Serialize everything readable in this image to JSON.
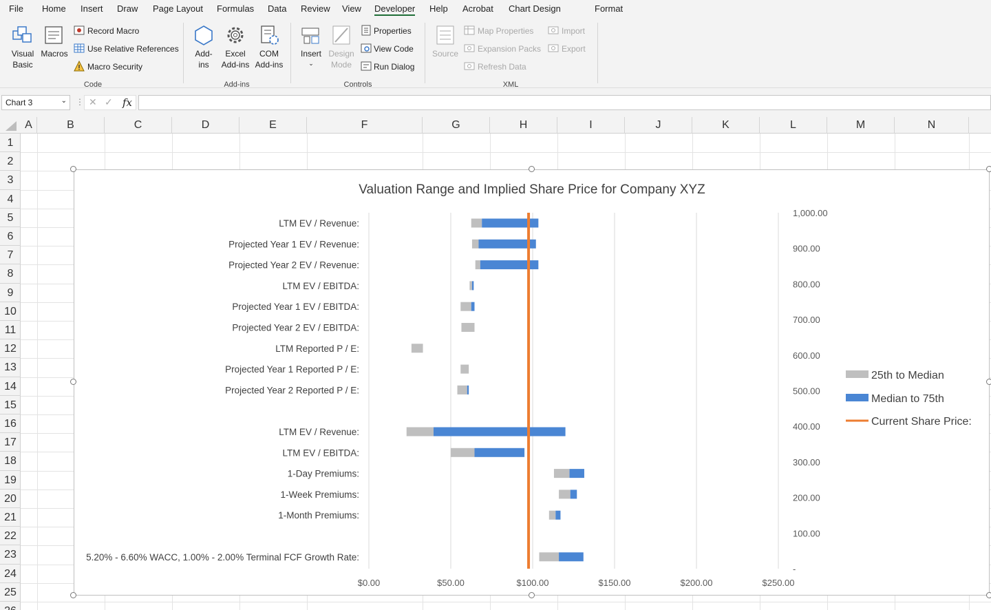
{
  "menu": {
    "items": [
      "File",
      "Home",
      "Insert",
      "Draw",
      "Page Layout",
      "Formulas",
      "Data",
      "Review",
      "View",
      "Developer",
      "Help",
      "Acrobat",
      "Chart Design",
      "Format"
    ],
    "active": "Developer"
  },
  "ribbon": {
    "code": {
      "visual_basic": [
        "Visual",
        "Basic"
      ],
      "macros": "Macros",
      "record_macro": "Record Macro",
      "use_relative": "Use Relative References",
      "macro_security": "Macro Security",
      "group": "Code"
    },
    "addins": {
      "addins": [
        "Add-",
        "ins"
      ],
      "excel_addins": [
        "Excel",
        "Add-ins"
      ],
      "com_addins": [
        "COM",
        "Add-ins"
      ],
      "group": "Add-ins"
    },
    "controls": {
      "insert": "Insert",
      "design_mode": [
        "Design",
        "Mode"
      ],
      "properties": "Properties",
      "view_code": "View Code",
      "run_dialog": "Run Dialog",
      "group": "Controls"
    },
    "xml": {
      "source": "Source",
      "map_properties": "Map Properties",
      "expansion_packs": "Expansion Packs",
      "refresh_data": "Refresh Data",
      "import": "Import",
      "export": "Export",
      "group": "XML"
    }
  },
  "formula_bar": {
    "name_box": "Chart 3",
    "fx": "fx",
    "formula": ""
  },
  "columns": [
    "A",
    "B",
    "C",
    "D",
    "E",
    "F",
    "G",
    "H",
    "I",
    "J",
    "K",
    "L",
    "M",
    "N"
  ],
  "rows": [
    "1",
    "2",
    "3",
    "4",
    "5",
    "6",
    "7",
    "8",
    "9",
    "10",
    "11",
    "12",
    "13",
    "14",
    "15",
    "16",
    "17",
    "18",
    "19",
    "20",
    "21",
    "22",
    "23",
    "24",
    "25",
    "26"
  ],
  "chart_data": {
    "type": "bar",
    "title": "Valuation Range and Implied Share Price for Company XYZ",
    "categories": [
      "LTM EV / Revenue:",
      "Projected Year 1 EV / Revenue:",
      "Projected Year 2 EV / Revenue:",
      "LTM EV / EBITDA:",
      "Projected Year 1 EV / EBITDA:",
      "Projected Year 2 EV / EBITDA:",
      "LTM Reported P / E:",
      "Projected Year 1 Reported P / E:",
      "Projected Year 2 Reported P / E:",
      "",
      "LTM EV / Revenue:",
      "LTM EV / EBITDA:",
      "1-Day Premiums:",
      "1-Week Premiums:",
      "1-Month Premiums:",
      "",
      "5.20% - 6.60% WACC, 1.00% - 2.00% Terminal FCF Growth Rate:"
    ],
    "series": [
      {
        "name": "25th to Median",
        "color": "#bfbfbf",
        "start": [
          62.5,
          63,
          65,
          61.5,
          56,
          56.5,
          26,
          56,
          54,
          null,
          23,
          50,
          113,
          116,
          110,
          null,
          104
        ],
        "end": [
          69,
          67,
          68,
          63,
          62.5,
          64.5,
          33,
          61,
          60,
          null,
          39.5,
          64.5,
          122.5,
          123,
          114,
          null,
          116
        ]
      },
      {
        "name": "Median to 75th",
        "color": "#4a86d4",
        "start": [
          69,
          67,
          68,
          63,
          62.5,
          64.5,
          33,
          61,
          60,
          null,
          39.5,
          64.5,
          122.5,
          123,
          114,
          null,
          116
        ],
        "end": [
          103.5,
          102,
          103.5,
          64,
          64.5,
          64.5,
          33,
          61,
          61,
          null,
          120,
          95,
          131.5,
          127,
          117,
          null,
          131
        ]
      },
      {
        "name": "Current Share Price:",
        "color": "#ed7d31",
        "value": 97.5
      }
    ],
    "x_axis": {
      "ticks": [
        "$0.00",
        "$50.00",
        "$100.00",
        "$150.00",
        "$200.00",
        "$250.00"
      ],
      "range": [
        0,
        250
      ]
    },
    "y2_axis": {
      "ticks": [
        "1,000.00",
        "900.00",
        "800.00",
        "700.00",
        "600.00",
        "500.00",
        "400.00",
        "300.00",
        "200.00",
        "100.00",
        "-"
      ],
      "range": [
        0,
        1000
      ]
    },
    "legend": "right",
    "gridlines": "vertical"
  }
}
